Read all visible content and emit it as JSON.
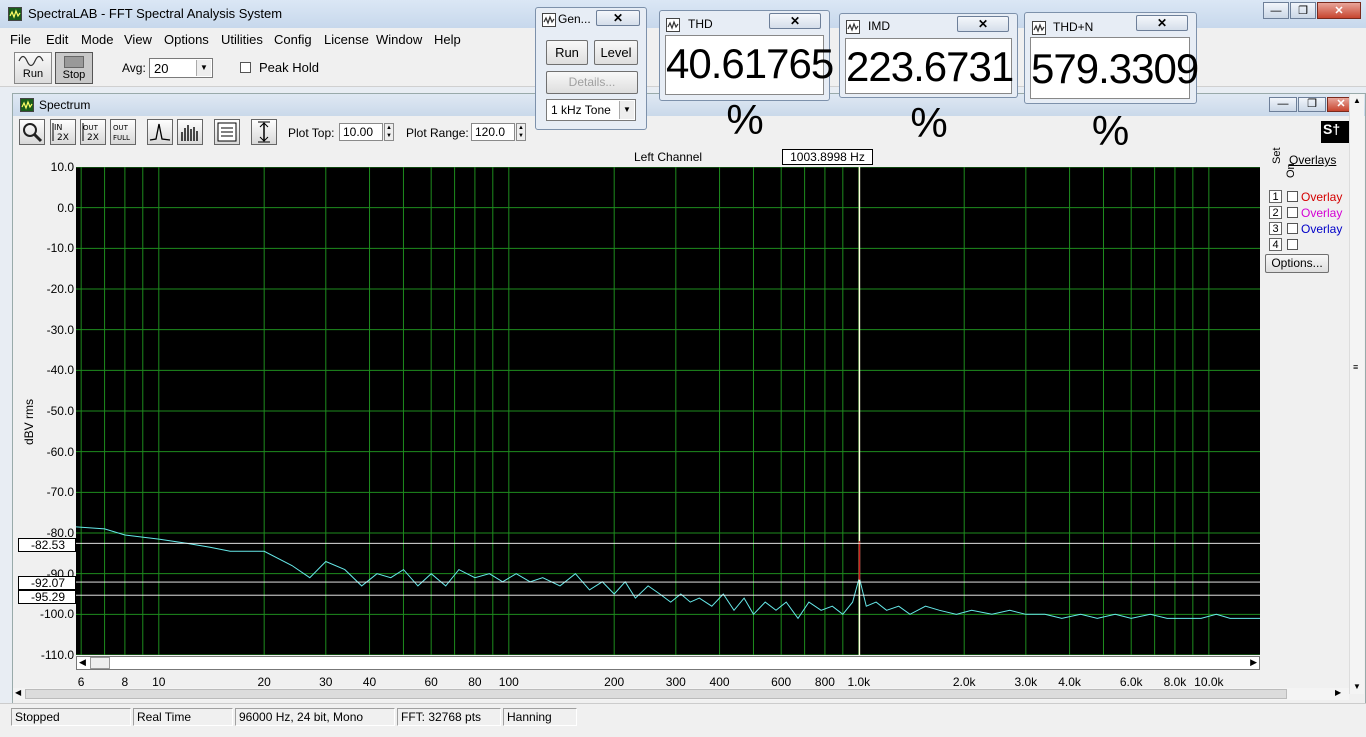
{
  "app": {
    "title": "SpectraLAB - FFT Spectral Analysis System",
    "menu": [
      "File",
      "Edit",
      "Mode",
      "View",
      "Options",
      "Utilities",
      "Config",
      "License",
      "Window",
      "Help"
    ]
  },
  "toolbar": {
    "run_label": "Run",
    "stop_label": "Stop",
    "avg_label": "Avg:",
    "avg_value": "20",
    "peak_hold_label": "Peak Hold",
    "peak_hold_checked": false
  },
  "generator": {
    "title": "Gen...",
    "run_label": "Run",
    "level_label": "Level",
    "details_label": "Details...",
    "tone_value": "1 kHz Tone"
  },
  "meters": {
    "thd": {
      "title": "THD",
      "value": "40.61765 %"
    },
    "imd": {
      "title": "IMD",
      "value": "223.6731 %"
    },
    "thdn": {
      "title": "THD+N",
      "value": "579.3309 %"
    }
  },
  "spectrum": {
    "title": "Spectrum",
    "plot_top_label": "Plot Top:",
    "plot_top_value": "10.00",
    "plot_range_label": "Plot Range:",
    "plot_range_value": "120.0",
    "channel_label": "Left Channel",
    "cursor_freq": "1003.8998 Hz",
    "markers": [
      "-82.53",
      "-92.07",
      "-95.29"
    ],
    "overlays": {
      "header": "Overlays",
      "set_label": "Set",
      "on_label": "On",
      "items": [
        {
          "num": "1",
          "label": "Overlay",
          "color": "#d40000"
        },
        {
          "num": "2",
          "label": "Overlay",
          "color": "#d400d4"
        },
        {
          "num": "3",
          "label": "Overlay",
          "color": "#0000c8"
        },
        {
          "num": "4",
          "label": "",
          "color": "#000000"
        }
      ],
      "options_label": "Options..."
    }
  },
  "chart_data": {
    "type": "line",
    "title": "Left Channel",
    "ylabel": "dBV rms",
    "xlabel": "",
    "x_scale": "log",
    "xlim": [
      5.8,
      14000
    ],
    "ylim": [
      -110,
      10
    ],
    "y_ticks": [
      "10.0",
      "0.0",
      "-10.0",
      "-20.0",
      "-30.0",
      "-40.0",
      "-50.0",
      "-60.0",
      "-70.0",
      "-80.0",
      "-90.0",
      "-100.0",
      "-110.0"
    ],
    "x_ticks": [
      {
        "v": 6,
        "label": "6"
      },
      {
        "v": 8,
        "label": "8"
      },
      {
        "v": 10,
        "label": "10"
      },
      {
        "v": 20,
        "label": "20"
      },
      {
        "v": 30,
        "label": "30"
      },
      {
        "v": 40,
        "label": "40"
      },
      {
        "v": 60,
        "label": "60"
      },
      {
        "v": 80,
        "label": "80"
      },
      {
        "v": 100,
        "label": "100"
      },
      {
        "v": 200,
        "label": "200"
      },
      {
        "v": 300,
        "label": "300"
      },
      {
        "v": 400,
        "label": "400"
      },
      {
        "v": 600,
        "label": "600"
      },
      {
        "v": 800,
        "label": "800"
      },
      {
        "v": 1000,
        "label": "1.0k"
      },
      {
        "v": 2000,
        "label": "2.0k"
      },
      {
        "v": 3000,
        "label": "3.0k"
      },
      {
        "v": 4000,
        "label": "4.0k"
      },
      {
        "v": 6000,
        "label": "6.0k"
      },
      {
        "v": 8000,
        "label": "8.0k"
      },
      {
        "v": 10000,
        "label": "10.0k"
      }
    ],
    "series": [
      {
        "color": "#66e8e8",
        "x": [
          5.8,
          7,
          8,
          10,
          12,
          14,
          16,
          20,
          24,
          27,
          30,
          34,
          38,
          42,
          46,
          50,
          55,
          60,
          66,
          72,
          80,
          88,
          96,
          105,
          115,
          125,
          140,
          155,
          170,
          185,
          200,
          215,
          230,
          250,
          270,
          290,
          310,
          330,
          350,
          380,
          410,
          440,
          470,
          500,
          540,
          580,
          620,
          670,
          720,
          780,
          840,
          900,
          960,
          1003,
          1050,
          1120,
          1200,
          1300,
          1400,
          1550,
          1700,
          1900,
          2100,
          2400,
          2700,
          3000,
          3400,
          3800,
          4300,
          4800,
          5400,
          6000,
          6800,
          7600,
          8500,
          9500,
          10500,
          11500,
          12500,
          13500,
          14000
        ],
        "values": [
          -78.5,
          -79,
          -80.5,
          -81.5,
          -82.5,
          -83.5,
          -84.5,
          -84.5,
          -88,
          -91,
          -87,
          -89,
          -93,
          -90,
          -91,
          -89,
          -93,
          -90,
          -93,
          -89,
          -91,
          -90,
          -92,
          -90,
          -92,
          -91,
          -93,
          -90,
          -94,
          -92,
          -95,
          -92,
          -96,
          -93,
          -95,
          -97,
          -95,
          -97,
          -96,
          -98,
          -95,
          -99,
          -96,
          -100,
          -97,
          -99,
          -97,
          -101,
          -97,
          -99,
          -98,
          -100,
          -97,
          -91,
          -98,
          -97,
          -99,
          -98,
          -100,
          -98,
          -99,
          -100,
          -99,
          -100,
          -99,
          -100,
          -100,
          -101,
          -100,
          -101,
          -100,
          -101,
          -100,
          -101,
          -101,
          -101,
          -100,
          -101,
          -101,
          -101,
          -101
        ]
      }
    ],
    "grid": true,
    "cursor_x": 1003.8998,
    "cursor_peak": -91.5
  },
  "status": {
    "state": "Stopped",
    "mode": "Real Time",
    "format": "96000 Hz, 24 bit, Mono",
    "fft": "FFT: 32768 pts",
    "window": "Hanning"
  }
}
